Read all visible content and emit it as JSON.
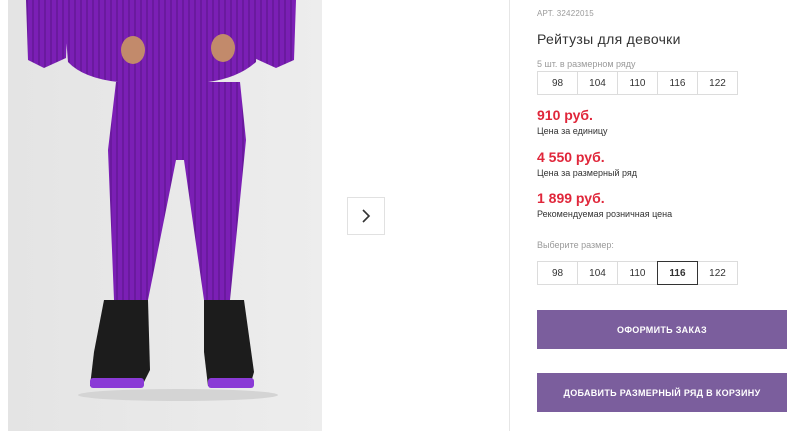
{
  "product": {
    "article": "АРТ. 32422015",
    "title": "Рейтузы для девочки"
  },
  "pack": {
    "label": "5 шт. в размерном ряду",
    "sizes": [
      "98",
      "104",
      "110",
      "116",
      "122"
    ]
  },
  "prices": {
    "unit_price": "910 руб.",
    "unit_label": "Цена за единицу",
    "pack_price": "4 550 руб.",
    "pack_label": "Цена за размерный ряд",
    "retail_price": "1 899 руб.",
    "retail_label": "Рекомендуемая розничная цена",
    "color": "#e0263a"
  },
  "size_picker": {
    "label": "Выберите размер:",
    "sizes": [
      "98",
      "104",
      "110",
      "116",
      "122"
    ],
    "selected": "116"
  },
  "buttons": {
    "order": "ОФОРМИТЬ ЗАКАЗ",
    "add_pack": "ДОБАВИТЬ РАЗМЕРНЫЙ РЯД В КОРЗИНУ",
    "color": "#7b5e9d"
  },
  "gallery": {
    "next_icon": "chevron-right-icon"
  }
}
